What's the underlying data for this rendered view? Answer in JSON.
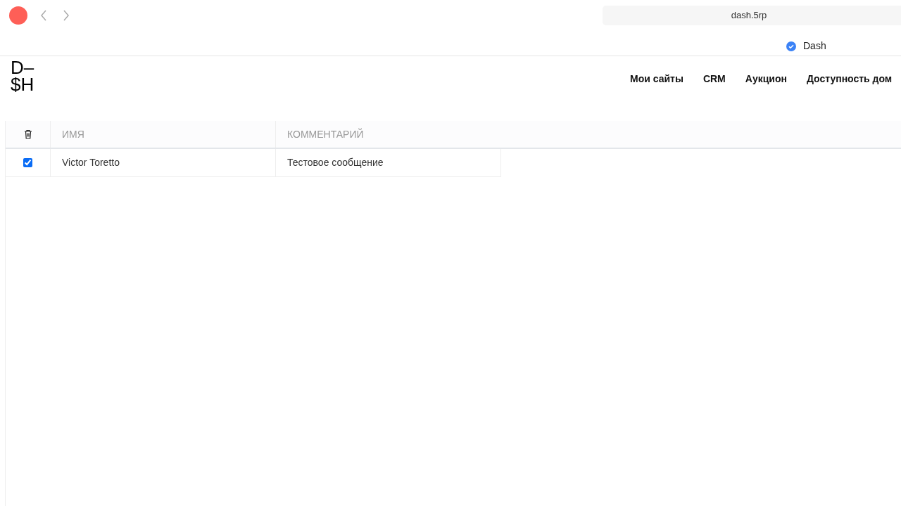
{
  "browser": {
    "address": "dash.5rp",
    "profile": {
      "name": "Dash",
      "verified": true
    }
  },
  "logo": {
    "lines": [
      "D–",
      "$H"
    ]
  },
  "nav": [
    "Мои сайты",
    "CRM",
    "Аукцион",
    "Доступность дом"
  ],
  "table": {
    "columns": [
      "ИМЯ",
      "КОММЕНТАРИЙ"
    ],
    "rows": [
      {
        "checked": true,
        "cells": [
          "Victor Toretto",
          "Тестовое сообщение"
        ]
      }
    ]
  }
}
